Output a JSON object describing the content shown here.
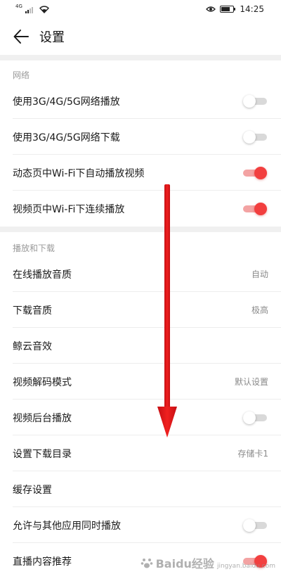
{
  "status_bar": {
    "network_label": "4G",
    "time": "14:25",
    "battery_level": 0.75
  },
  "header": {
    "title": "设置"
  },
  "sections": [
    {
      "label": "网络",
      "rows": [
        {
          "label": "使用3G/4G/5G网络播放",
          "toggle": false
        },
        {
          "label": "使用3G/4G/5G网络下载",
          "toggle": false
        },
        {
          "label": "动态页中Wi-Fi下自动播放视频",
          "toggle": true
        },
        {
          "label": "视频页中Wi-Fi下连续播放",
          "toggle": true
        }
      ]
    },
    {
      "label": "播放和下载",
      "rows": [
        {
          "label": "在线播放音质",
          "value": "自动"
        },
        {
          "label": "下载音质",
          "value": "极高"
        },
        {
          "label": "鲸云音效",
          "value": ""
        },
        {
          "label": "视频解码模式",
          "value": "默认设置"
        },
        {
          "label": "视频后台播放",
          "toggle": false
        },
        {
          "label": "设置下载目录",
          "value": "存储卡1"
        },
        {
          "label": "缓存设置",
          "value": ""
        },
        {
          "label": "允许与其他应用同时播放",
          "toggle": false
        },
        {
          "label": "直播内容推荐",
          "toggle": true
        }
      ]
    }
  ],
  "watermark": {
    "text": "Baidu经验",
    "sub": "jingyan.baidu.com"
  },
  "colors": {
    "accent": "#f23f3f",
    "arrow": "#e8141a",
    "section_label": "#9a9a9a",
    "divider_band": "#f0f0f0"
  }
}
